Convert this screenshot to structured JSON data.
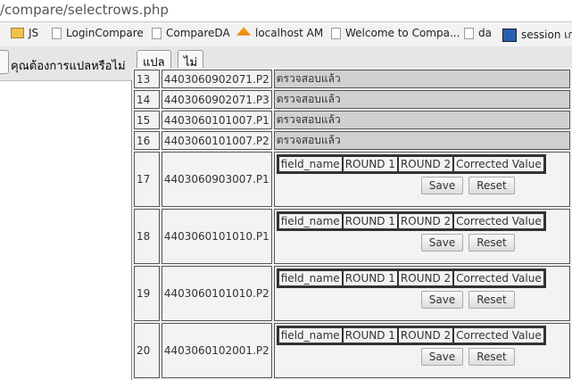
{
  "url": "/compare/selectrows.php",
  "bookmarks": [
    {
      "icon": "folder-icon",
      "label": "JS"
    },
    {
      "icon": "page-icon",
      "label": "LoginCompare"
    },
    {
      "icon": "page-icon",
      "label": "CompareDA"
    },
    {
      "icon": "phpmyadmin-icon",
      "label": "localhost AM"
    },
    {
      "icon": "page-icon",
      "label": "Welcome to Compa..."
    },
    {
      "icon": "page-icon",
      "label": "da"
    },
    {
      "icon": "session-icon",
      "label": "session เกส"
    }
  ],
  "translate": {
    "prompt": "คุณต้องการแปลหรือไม่",
    "translate_label": "แปล",
    "no_label": "ไม่"
  },
  "simple_rows": [
    {
      "n": "13",
      "id": "4403060902071.P2",
      "status": "ตรวจสอบแล้ว"
    },
    {
      "n": "14",
      "id": "4403060902071.P3",
      "status": "ตรวจสอบแล้ว"
    },
    {
      "n": "15",
      "id": "4403060101007.P1",
      "status": "ตรวจสอบแล้ว"
    },
    {
      "n": "16",
      "id": "4403060101007.P2",
      "status": "ตรวจสอบแล้ว"
    }
  ],
  "edit_rows": [
    {
      "n": "17",
      "id": "4403060903007.P1"
    },
    {
      "n": "18",
      "id": "4403060101010.P1"
    },
    {
      "n": "19",
      "id": "4403060101010.P2"
    },
    {
      "n": "20",
      "id": "4403060102001.P2"
    }
  ],
  "inner_headers": [
    "field_name",
    "ROUND 1",
    "ROUND 2",
    "Corrected Value"
  ],
  "save_label": "Save",
  "reset_label": "Reset"
}
